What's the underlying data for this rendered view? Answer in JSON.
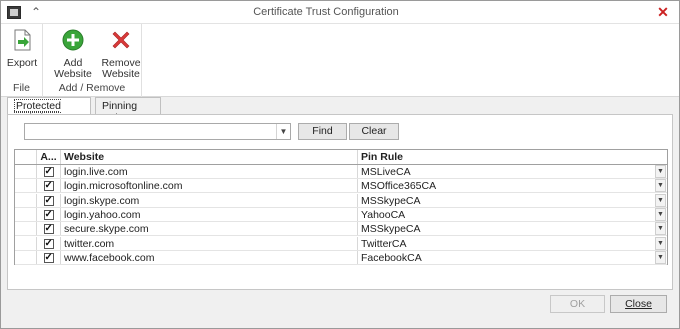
{
  "window": {
    "title": "Certificate Trust Configuration"
  },
  "ribbon": {
    "groups": [
      {
        "label": "File",
        "buttons": [
          {
            "label": "Export"
          }
        ]
      },
      {
        "label": "Add / Remove",
        "buttons": [
          {
            "label": "Add Website"
          },
          {
            "label": "Remove Website"
          }
        ]
      }
    ],
    "icons": {
      "export": "export-icon",
      "add": "add-icon",
      "remove": "remove-icon"
    },
    "colors": {
      "add_green": "#3aa53a",
      "remove_red": "#d93a3a"
    }
  },
  "tabs": [
    {
      "label": "Protected Websites",
      "active": true
    },
    {
      "label": "Pinning Rules",
      "underline_char": "R",
      "active": false
    }
  ],
  "search": {
    "value": "",
    "find_label": "Find",
    "clear_label": "Clear"
  },
  "grid": {
    "columns": [
      "A...",
      "Website",
      "Pin Rule"
    ],
    "rows": [
      {
        "checked": true,
        "website": "login.live.com",
        "pin_rule": "MSLiveCA"
      },
      {
        "checked": true,
        "website": "login.microsoftonline.com",
        "pin_rule": "MSOffice365CA"
      },
      {
        "checked": true,
        "website": "login.skype.com",
        "pin_rule": "MSSkypeCA"
      },
      {
        "checked": true,
        "website": "login.yahoo.com",
        "pin_rule": "YahooCA"
      },
      {
        "checked": true,
        "website": "secure.skype.com",
        "pin_rule": "MSSkypeCA"
      },
      {
        "checked": true,
        "website": "twitter.com",
        "pin_rule": "TwitterCA"
      },
      {
        "checked": true,
        "website": "www.facebook.com",
        "pin_rule": "FacebookCA"
      }
    ]
  },
  "footer": {
    "ok_label": "OK",
    "close_label": "Close",
    "ok_enabled": false
  }
}
